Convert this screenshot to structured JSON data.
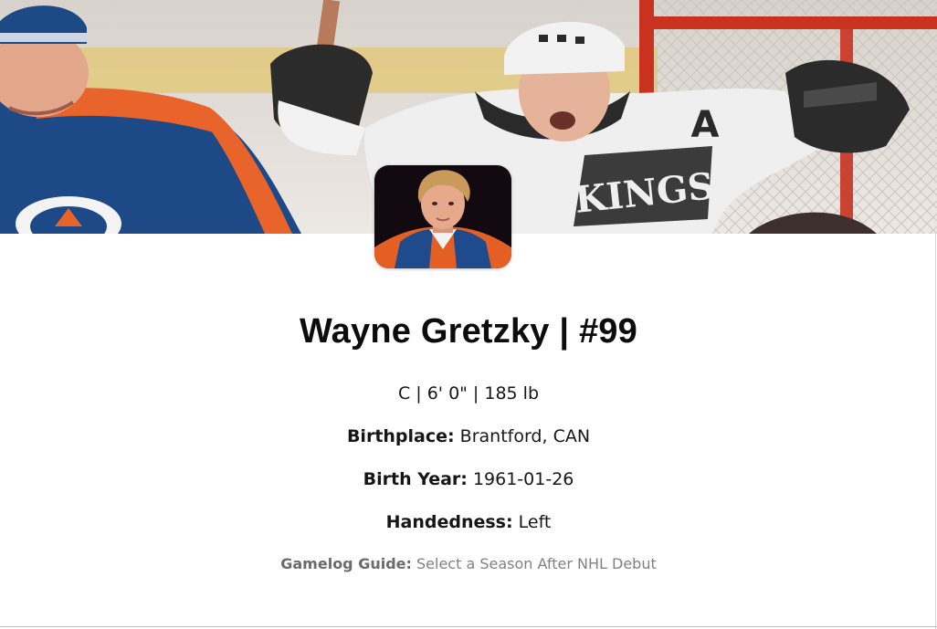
{
  "player": {
    "name_line": "Wayne Gretzky | #99",
    "vitals": "C | 6' 0\" | 185 lb",
    "details": [
      {
        "label": "Birthplace:",
        "value": "Brantford, CAN"
      },
      {
        "label": "Birth Year:",
        "value": "1961-01-26"
      },
      {
        "label": "Handedness:",
        "value": "Left"
      }
    ]
  },
  "gamelog_guide": {
    "label": "Gamelog Guide:",
    "text": "Select a Season After NHL Debut"
  },
  "banner": {
    "jersey_text": "KINGS",
    "captain_letter": "A"
  },
  "colors": {
    "oilers_blue": "#1d4a86",
    "oilers_orange": "#e8642a",
    "kings_white": "#efefef",
    "kings_black": "#2a2a2a",
    "net_red": "#c8321f"
  }
}
